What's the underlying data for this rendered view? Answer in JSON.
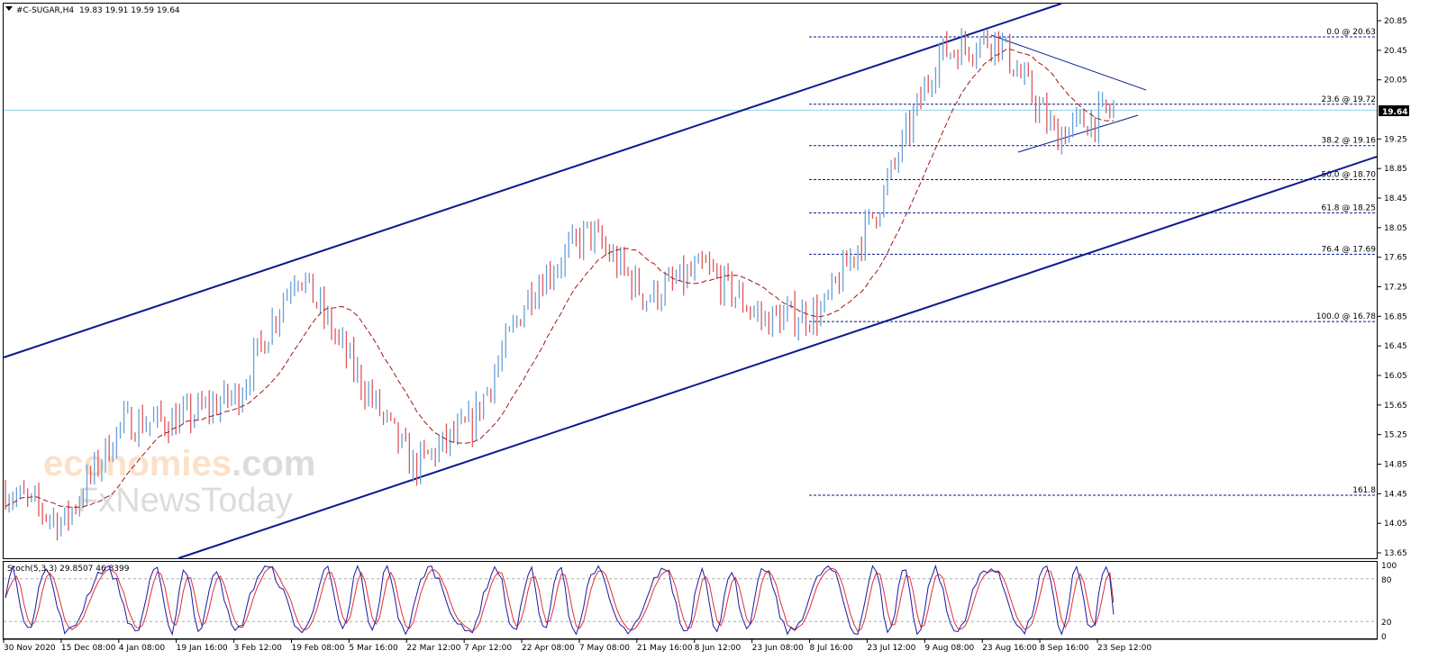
{
  "header": {
    "symbol": "#C-SUGAR,H4",
    "ohlc": "19.83 19.91 19.59 19.64"
  },
  "watermark": {
    "line1_part1": "economies",
    "line1_part2": ".com",
    "line2": "FxNewsToday"
  },
  "current_price_label": "19.64",
  "stoch_label": "Stoch(5,3,3) 29.8507 46.8399",
  "colors": {
    "bull": "#6a9fd4",
    "bear": "#e0555a",
    "channel": "#0a1a8c",
    "ma": "#a01818",
    "fib": "#0a1a8c",
    "stoch_main": "#1a1aa0",
    "stoch_signal": "#e0303a",
    "price_line": "#8fd3e8"
  },
  "chart_data": {
    "type": "candlestick",
    "instrument": "#C-SUGAR",
    "timeframe": "H4",
    "last_close": 19.64,
    "ylim": [
      13.65,
      20.85
    ],
    "y_ticks": [
      20.85,
      20.45,
      20.05,
      19.64,
      19.25,
      18.85,
      18.45,
      18.05,
      17.65,
      17.25,
      16.85,
      16.45,
      16.05,
      15.65,
      15.25,
      14.85,
      14.45,
      14.05,
      13.65
    ],
    "x_ticks": [
      "30 Nov 2020",
      "15 Dec 08:00",
      "4 Jan 08:00",
      "19 Jan 16:00",
      "3 Feb 12:00",
      "19 Feb 08:00",
      "5 Mar 16:00",
      "22 Mar 12:00",
      "7 Apr 12:00",
      "22 Apr 08:00",
      "7 May 08:00",
      "21 May 16:00",
      "8 Jun 12:00",
      "23 Jun 08:00",
      "8 Jul 16:00",
      "23 Jul 12:00",
      "9 Aug 08:00",
      "23 Aug 16:00",
      "8 Sep 16:00",
      "23 Sep 12:00"
    ],
    "price_path": [
      [
        "30 Nov 2020",
        14.5
      ],
      [
        "15 Dec 08:00",
        14.05
      ],
      [
        "4 Jan 08:00",
        15.4
      ],
      [
        "19 Jan 16:00",
        15.45
      ],
      [
        "3 Feb 12:00",
        15.8
      ],
      [
        "19 Feb 08:00",
        17.5
      ],
      [
        "5 Mar 16:00",
        16.1
      ],
      [
        "22 Mar 12:00",
        14.8
      ],
      [
        "7 Apr 12:00",
        15.4
      ],
      [
        "22 Apr 08:00",
        17.2
      ],
      [
        "7 May 08:00",
        18.0
      ],
      [
        "21 May 16:00",
        17.1
      ],
      [
        "8 Jun 12:00",
        17.5
      ],
      [
        "23 Jun 08:00",
        16.8
      ],
      [
        "8 Jul 16:00",
        16.9
      ],
      [
        "23 Jul 12:00",
        18.4
      ],
      [
        "9 Aug 08:00",
        20.4
      ],
      [
        "23 Aug 16:00",
        20.63
      ],
      [
        "8 Sep 16:00",
        19.3
      ],
      [
        "23 Sep 12:00",
        19.64
      ]
    ],
    "fibonacci": [
      {
        "label": "0.0 @ 20.63",
        "price": 20.63
      },
      {
        "label": "23.6 @ 19.72",
        "price": 19.72
      },
      {
        "label": "38.2 @ 19.16",
        "price": 19.16
      },
      {
        "label": "50.0 @ 18.70",
        "price": 18.7
      },
      {
        "label": "61.8 @ 18.25",
        "price": 18.25
      },
      {
        "label": "76.4 @ 17.69",
        "price": 17.69
      },
      {
        "label": "100.0 @ 16.78",
        "price": 16.78
      },
      {
        "label": "161.8",
        "price": 14.43
      }
    ],
    "stochastic": {
      "params": "5,3,3",
      "main": 29.8507,
      "signal": 46.8399,
      "levels": [
        20,
        80
      ],
      "axis_ticks": [
        100,
        80,
        20,
        0
      ]
    }
  }
}
